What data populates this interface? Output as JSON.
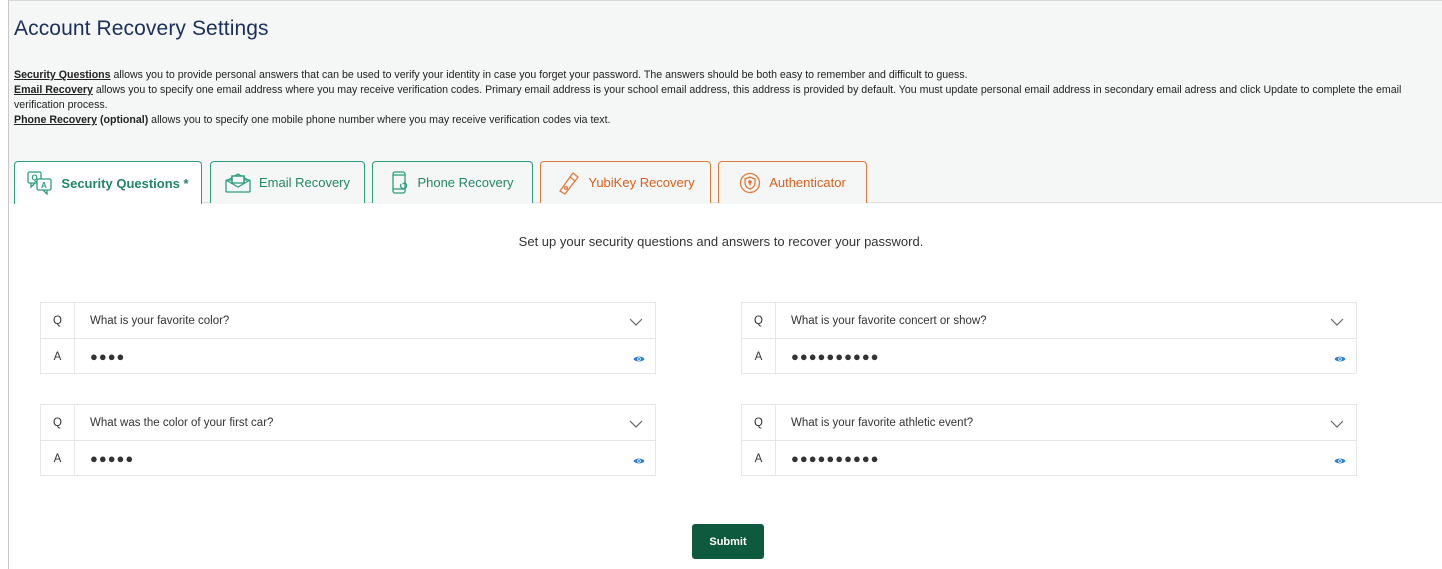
{
  "page": {
    "title": "Account Recovery Settings"
  },
  "description": {
    "security": {
      "link": "Security Questions",
      "text": " allows you to provide personal answers that can be used to verify your identity in case you forget your password. The answers should be both easy to remember and difficult to guess."
    },
    "email": {
      "link": "Email Recovery",
      "text": " allows you to specify one email address where you may receive verification codes. Primary email address is your school email address, this address is provided by default. You must update personal email address in secondary email adress and click Update to complete the email verification process."
    },
    "phone": {
      "link": "Phone Recovery",
      "optional": " (optional)",
      "text": " allows you to specify one mobile phone number where you may receive verification codes via text."
    }
  },
  "tabs": [
    {
      "label": "Security Questions *",
      "icon": "qa-icon",
      "active": true
    },
    {
      "label": "Email Recovery",
      "icon": "envelope-icon"
    },
    {
      "label": "Phone Recovery",
      "icon": "phone-icon"
    },
    {
      "label": "YubiKey Recovery",
      "icon": "key-icon"
    },
    {
      "label": "Authenticator",
      "icon": "shield-icon"
    }
  ],
  "intro": "Set up your security questions and answers to recover your password.",
  "qa": {
    "q_letter": "Q",
    "a_letter": "A",
    "items": [
      {
        "question": "What is your favorite color?",
        "answer": "●●●●"
      },
      {
        "question": "What is your favorite concert or show?",
        "answer": "●●●●●●●●●●"
      },
      {
        "question": "What was the color of your first car?",
        "answer": "●●●●●"
      },
      {
        "question": "What is your favorite athletic event?",
        "answer": "●●●●●●●●●●"
      }
    ]
  },
  "submit_label": "Submit",
  "colors": {
    "green": "#238567",
    "orange": "#d9601c",
    "submit": "#0e5a3f",
    "eye": "#2b7fd1",
    "title": "#1b2f5c"
  }
}
